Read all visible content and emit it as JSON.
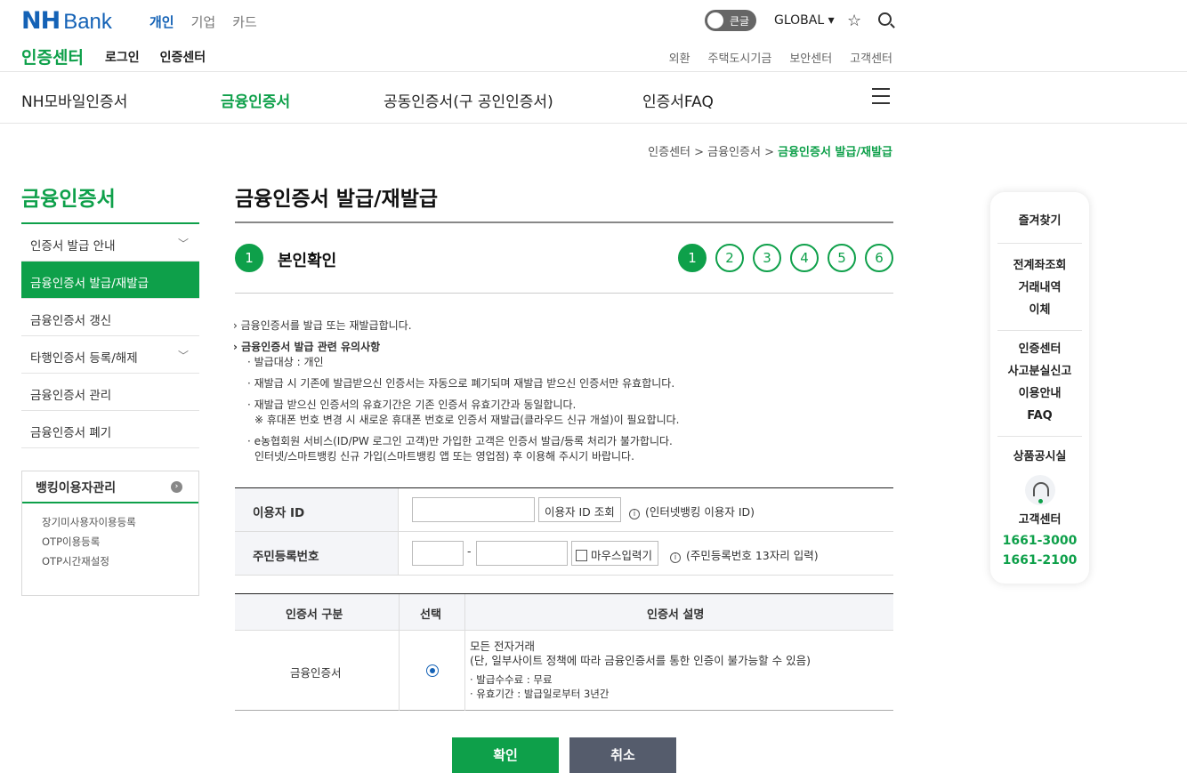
{
  "header": {
    "logo_nh": "NH",
    "logo_bank": "Bank",
    "top_nav": [
      "개인",
      "기업",
      "카드"
    ],
    "toggle_label": "큰글",
    "global_label": "GLOBAL ▾",
    "sub_title": "인증센터",
    "sub_links": [
      "로그인",
      "인증센터"
    ],
    "util_links": [
      "외환",
      "주택도시기금",
      "보안센터",
      "고객센터"
    ]
  },
  "gnb": [
    "NH모바일인증서",
    "금융인증서",
    "공동인증서(구 공인인증서)",
    "인증서FAQ"
  ],
  "breadcrumb": {
    "path": "인증센터 > 금융인증서 > ",
    "current": "금융인증서 발급/재발급"
  },
  "lnb": {
    "title": "금융인증서",
    "items": [
      "인증서 발급 안내",
      "금융인증서 발급/재발급",
      "금융인증서 갱신",
      "타행인증서 등록/해제",
      "금융인증서 관리",
      "금융인증서 폐기"
    ],
    "banking_title": "뱅킹이용자관리",
    "banking_links": [
      "장기미사용자이용등록",
      "OTP이용등록",
      "OTP시간재설정"
    ]
  },
  "content": {
    "title": "금융인증서 발급/재발급",
    "step_num": "1",
    "step_title": "본인확인",
    "steps": [
      "1",
      "2",
      "3",
      "4",
      "5",
      "6"
    ],
    "notes": {
      "n1": "› 금융인증서를 발급 또는 재발급합니다.",
      "n2": "› 금융인증서 발급 관련 유의사항",
      "n3": "· 발급대상 : 개인",
      "n4": "· 재발급 시 기존에 발급받으신 인증서는 자동으로 폐기되며 재발급 받으신 인증서만 유효합니다.",
      "n5": "· 재발급 받으신 인증서의 유효기간은 기존 인증서 유효기간과 동일합니다.",
      "n6": "※ 휴대폰 번호 변경 시 새로운 휴대폰 번호로 인증서 재발급(클라우드 신규 개설)이 필요합니다.",
      "n7": "· e농협회원 서비스(ID/PW 로그인 고객)만 가입한 고객은 인증서 발급/등록 처리가 불가합니다.",
      "n8": "인터넷/스마트뱅킹 신규 가입(스마트뱅킹 앱 또는 영업점) 후 이용해 주시기 바랍니다."
    },
    "form": {
      "user_id_label": "이용자 ID",
      "user_id_value": "",
      "user_id_btn": "이용자 ID 조회",
      "user_id_info": "(인터넷뱅킹 이용자 ID)",
      "rrn_label": "주민등록번호",
      "rrn_first": "",
      "rrn_second": "",
      "rrn_dash": "-",
      "mouse_input": "마우스입력기",
      "rrn_info": "(주민등록번호 13자리 입력)"
    },
    "cert_table": {
      "headers": [
        "인증서 구분",
        "선택",
        "인증서 설명"
      ],
      "row_type": "금융인증서",
      "desc1": "모든 전자거래",
      "desc2": "(단, 일부사이트 정책에 따라 금융인증서를 통한 인증이 불가능할 수 있음)",
      "desc3": "· 발급수수료 : 무료",
      "desc4": "· 유효기간 : 발급일로부터 3년간"
    },
    "ok_btn": "확인",
    "cancel_btn": "취소"
  },
  "quick": {
    "fav": "즐겨찾기",
    "group1": [
      "전계좌조회",
      "거래내역",
      "이체"
    ],
    "group2": [
      "인증센터",
      "사고분실신고",
      "이용안내",
      "FAQ"
    ],
    "product": "상품공시실",
    "cs": "고객센터",
    "tel1": "1661-3000",
    "tel2": "1661-2100"
  }
}
